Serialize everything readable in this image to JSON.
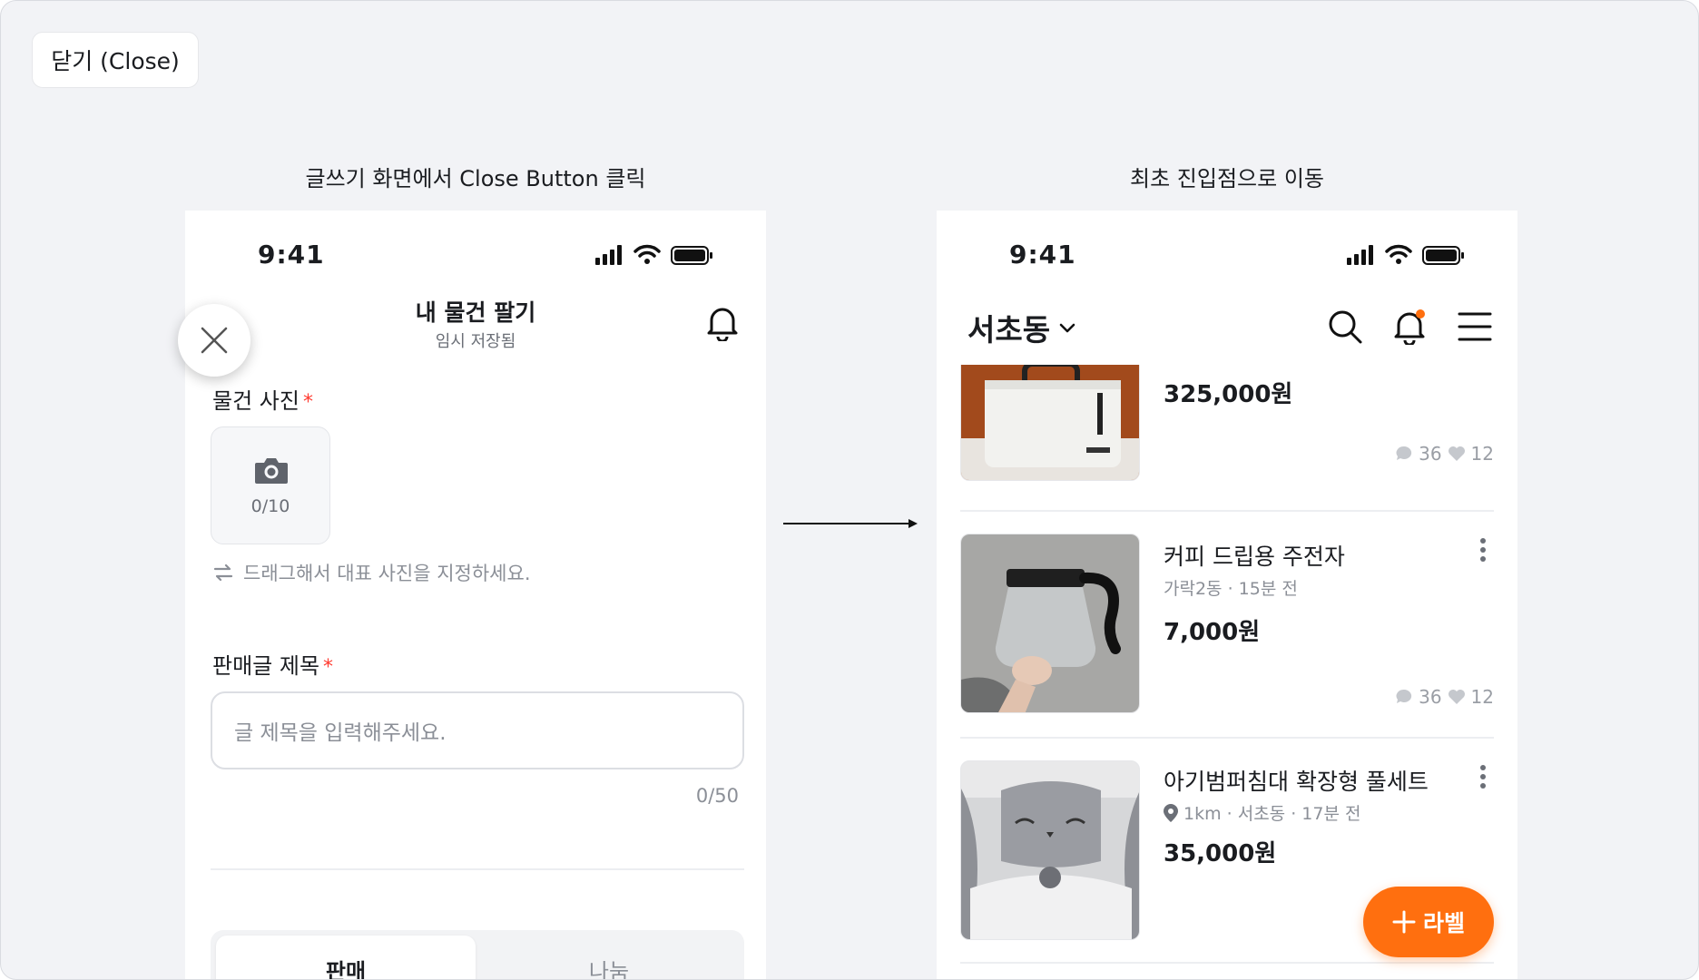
{
  "tag_label": "닫기 (Close)",
  "left": {
    "caption": "글쓰기 화면에서 Close Button 클릭",
    "status_time": "9:41",
    "title": "내 물건 팔기",
    "subtitle": "임시 저장됨",
    "photo_label": "물건 사진",
    "required_mark": "*",
    "photo_count": "0/10",
    "drag_hint": "드래그해서 대표 사진을 지정하세요.",
    "title_label": "판매글 제목",
    "title_placeholder": "글 제목을 입력해주세요.",
    "title_counter": "0/50",
    "segments": [
      "판매",
      "나눔"
    ]
  },
  "right": {
    "caption": "최초 진입점으로 이동",
    "status_time": "9:41",
    "location": "서초동",
    "items": [
      {
        "title": "",
        "meta": "",
        "price": "325,000원",
        "chats": "36",
        "likes": "12"
      },
      {
        "title": "커피 드립용 주전자",
        "meta": "가락2동 · 15분 전",
        "price": "7,000원",
        "chats": "36",
        "likes": "12"
      },
      {
        "title": "아기범퍼침대 확장형 풀세트",
        "meta": "1km · 서초동 · 17분 전",
        "price": "35,000원",
        "chats": "",
        "likes": ""
      }
    ],
    "fab_label": "라벨"
  },
  "colors": {
    "accent": "#ff6f0f",
    "required": "#ff3b30",
    "text": "#1a1c20",
    "muted": "#8b8f97"
  }
}
